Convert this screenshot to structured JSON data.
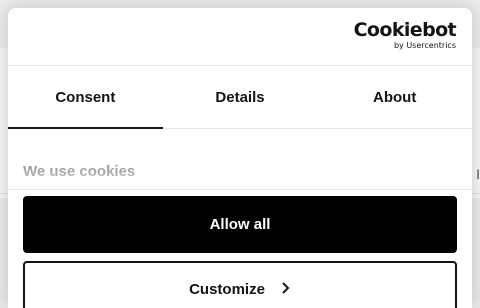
{
  "brand": {
    "name": "Cookiebot",
    "subtitle": "by Usercentrics"
  },
  "tabs": [
    {
      "label": "Consent",
      "active": true
    },
    {
      "label": "Details",
      "active": false
    },
    {
      "label": "About",
      "active": false
    }
  ],
  "content": {
    "heading": "We use cookies"
  },
  "buttons": {
    "allow_all": "Allow all",
    "customize": "Customize"
  },
  "background": {
    "edge_char": "I"
  },
  "colors": {
    "primary": "#000000",
    "text": "#141414",
    "surface": "#ffffff"
  },
  "icons": {
    "customize_chevron": "chevron-right-icon"
  }
}
